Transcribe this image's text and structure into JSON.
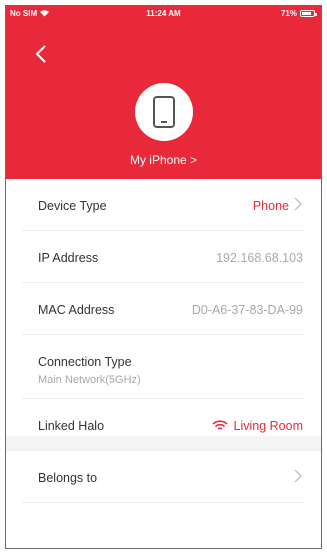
{
  "status": {
    "carrier": "No SIM",
    "time": "11:24 AM",
    "battery": "71%"
  },
  "device": {
    "name_link": "My iPhone >"
  },
  "rows": {
    "device_type": {
      "label": "Device Type",
      "value": "Phone"
    },
    "ip": {
      "label": "IP Address",
      "value": "192.168.68.103"
    },
    "mac": {
      "label": "MAC Address",
      "value": "D0-A6-37-83-DA-99"
    },
    "connection": {
      "label": "Connection Type",
      "sub": "Main Network(5GHz)"
    },
    "linked": {
      "label": "Linked Halo",
      "value": "Living Room"
    },
    "belongs": {
      "label": "Belongs to"
    }
  },
  "colors": {
    "accent": "#e8293a",
    "muted": "#a8a8a8"
  },
  "icons": [
    "back-icon",
    "phone-icon",
    "wifi-icon",
    "chevron-right-icon"
  ]
}
